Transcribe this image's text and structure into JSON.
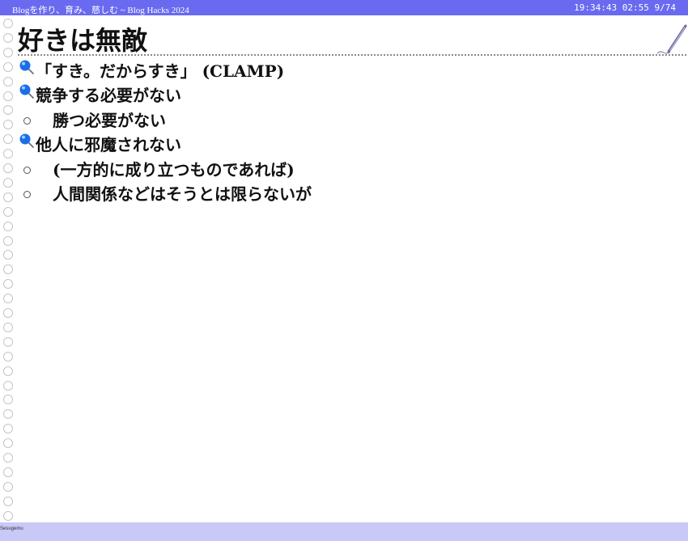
{
  "header": {
    "title": "Blogを作り、育み、慈しむ ~ Blog Hacks 2024",
    "clock": "19:34:43",
    "elapsed": "02:55",
    "page": "9/74"
  },
  "slide": {
    "title": "好きは無敵",
    "items": [
      {
        "text": "「すき。だからすき」 (CLAMP)",
        "level": 1
      },
      {
        "text": "競争する必要がない",
        "level": 1
      },
      {
        "text": "勝つ必要がない",
        "level": 2
      },
      {
        "text": "他人に邪魔されない",
        "level": 1
      },
      {
        "text": "(一方的に成り立つものであれば)",
        "level": 2
      },
      {
        "text": "人間関係などはそうとは限らないが",
        "level": 2
      }
    ]
  },
  "footer": {
    "label": "Sesugemu"
  },
  "colors": {
    "header_bg": "#6a6af0",
    "footer_bg": "#c9c9f8",
    "pin_color": "#1a6ee8",
    "text_color": "#111111"
  },
  "icons": {
    "level1_bullet": "pushpin-icon",
    "level2_bullet": "circle-bullet-icon",
    "corner": "pen-icon",
    "margin": "notebook-ring-icon"
  }
}
